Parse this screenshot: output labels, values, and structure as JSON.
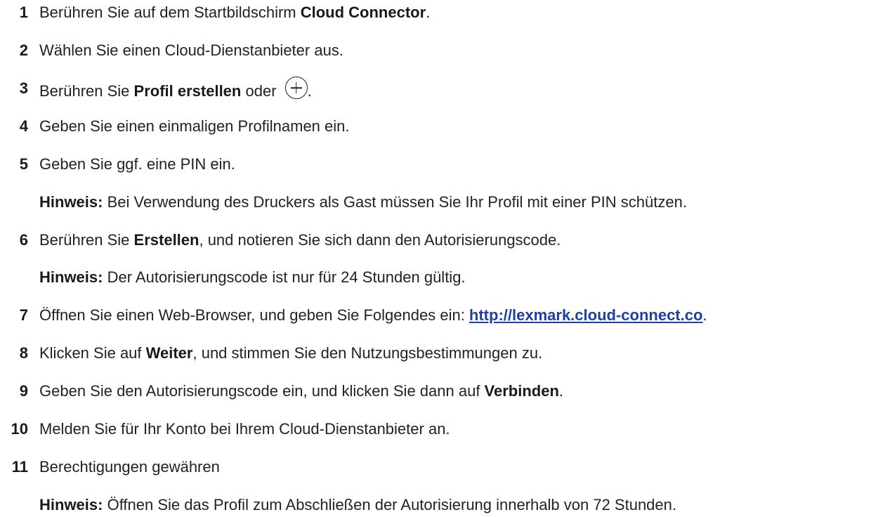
{
  "steps": [
    {
      "num": "1",
      "pre": "Berühren Sie auf dem Startbildschirm ",
      "bold": "Cloud Connector",
      "post": "."
    },
    {
      "num": "2",
      "text": "Wählen Sie einen Cloud-Dienstanbieter aus."
    },
    {
      "num": "3",
      "pre": "Berühren Sie ",
      "bold": "Profil erstellen",
      "mid": " oder ",
      "icon": "plus-circle-icon",
      "post": "."
    },
    {
      "num": "4",
      "text": "Geben Sie einen einmaligen Profilnamen ein."
    },
    {
      "num": "5",
      "text": "Geben Sie ggf. eine PIN ein.",
      "note": {
        "label": "Hinweis:",
        "text": " Bei Verwendung des Druckers als Gast müssen Sie Ihr Profil mit einer PIN schützen."
      }
    },
    {
      "num": "6",
      "pre": "Berühren Sie ",
      "bold": "Erstellen",
      "post": ", und notieren Sie sich dann den Autorisierungscode.",
      "note": {
        "label": "Hinweis:",
        "text": " Der Autorisierungscode ist nur für 24 Stunden gültig."
      }
    },
    {
      "num": "7",
      "pre": "Öffnen Sie einen Web-Browser, und geben Sie Folgendes ein: ",
      "link": "http://lexmark.cloud-connect.co",
      "post": "."
    },
    {
      "num": "8",
      "pre": "Klicken Sie auf ",
      "bold": "Weiter",
      "post": ", und stimmen Sie den Nutzungsbestimmungen zu."
    },
    {
      "num": "9",
      "pre": "Geben Sie den Autorisierungscode ein, und klicken Sie dann auf ",
      "bold": "Verbinden",
      "post": "."
    },
    {
      "num": "10",
      "text": "Melden Sie für Ihr Konto bei Ihrem Cloud-Dienstanbieter an."
    },
    {
      "num": "11",
      "text": "Berechtigungen gewähren",
      "note": {
        "label": "Hinweis:",
        "text": " Öffnen Sie das Profil zum Abschließen der Autorisierung innerhalb von 72 Stunden."
      }
    }
  ],
  "colors": {
    "text": "#222222",
    "link": "#1f3fa8"
  }
}
